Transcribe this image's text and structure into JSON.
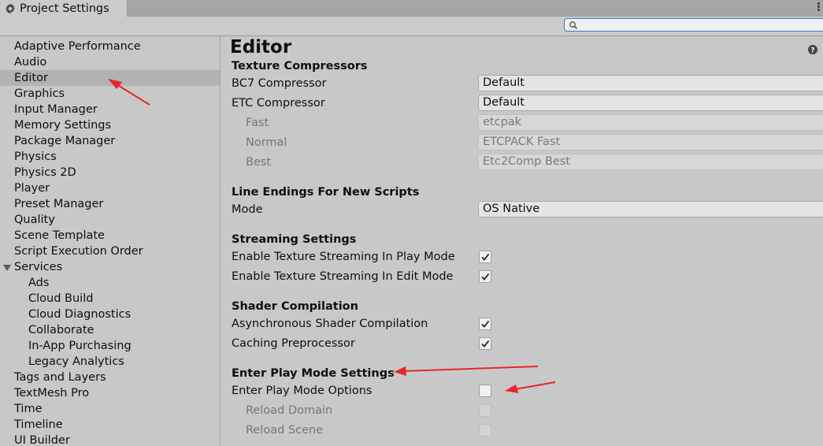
{
  "window": {
    "tab_title": "Project Settings",
    "tab_icon": "gear-icon"
  },
  "search": {
    "placeholder": "",
    "value": ""
  },
  "sidebar": {
    "items": [
      {
        "label": "Adaptive Performance",
        "level": 0
      },
      {
        "label": "Audio",
        "level": 0
      },
      {
        "label": "Editor",
        "level": 0,
        "selected": true
      },
      {
        "label": "Graphics",
        "level": 0
      },
      {
        "label": "Input Manager",
        "level": 0
      },
      {
        "label": "Memory Settings",
        "level": 0
      },
      {
        "label": "Package Manager",
        "level": 0
      },
      {
        "label": "Physics",
        "level": 0
      },
      {
        "label": "Physics 2D",
        "level": 0
      },
      {
        "label": "Player",
        "level": 0
      },
      {
        "label": "Preset Manager",
        "level": 0
      },
      {
        "label": "Quality",
        "level": 0
      },
      {
        "label": "Scene Template",
        "level": 0
      },
      {
        "label": "Script Execution Order",
        "level": 0
      },
      {
        "label": "Services",
        "level": 0,
        "expanded": true
      },
      {
        "label": "Ads",
        "level": 1
      },
      {
        "label": "Cloud Build",
        "level": 1
      },
      {
        "label": "Cloud Diagnostics",
        "level": 1
      },
      {
        "label": "Collaborate",
        "level": 1
      },
      {
        "label": "In-App Purchasing",
        "level": 1
      },
      {
        "label": "Legacy Analytics",
        "level": 1
      },
      {
        "label": "Tags and Layers",
        "level": 0
      },
      {
        "label": "TextMesh Pro",
        "level": 0
      },
      {
        "label": "Time",
        "level": 0
      },
      {
        "label": "Timeline",
        "level": 0
      },
      {
        "label": "UI Builder",
        "level": 0
      }
    ]
  },
  "main": {
    "title": "Editor",
    "help_icon": "help-icon",
    "texture_compressors": {
      "title": "Texture Compressors",
      "bc7_label": "BC7 Compressor",
      "bc7_value": "Default",
      "etc_label": "ETC Compressor",
      "etc_value": "Default",
      "fast_label": "Fast",
      "fast_value": "etcpak",
      "normal_label": "Normal",
      "normal_value": "ETCPACK Fast",
      "best_label": "Best",
      "best_value": "Etc2Comp Best"
    },
    "line_endings": {
      "title": "Line Endings For New Scripts",
      "mode_label": "Mode",
      "mode_value": "OS Native"
    },
    "streaming": {
      "title": "Streaming Settings",
      "play_label": "Enable Texture Streaming In Play Mode",
      "play_checked": true,
      "edit_label": "Enable Texture Streaming In Edit Mode",
      "edit_checked": true
    },
    "shader": {
      "title": "Shader Compilation",
      "async_label": "Asynchronous Shader Compilation",
      "async_checked": true,
      "cache_label": "Caching Preprocessor",
      "cache_checked": true
    },
    "play_mode": {
      "title": "Enter Play Mode Settings",
      "options_label": "Enter Play Mode Options",
      "options_checked": false,
      "domain_label": "Reload Domain",
      "domain_checked": false,
      "scene_label": "Reload Scene",
      "scene_checked": false
    }
  },
  "colors": {
    "annotation_arrow": "#e8262d",
    "selected_row": "#b2b2b2",
    "search_border": "#3b78c9"
  }
}
